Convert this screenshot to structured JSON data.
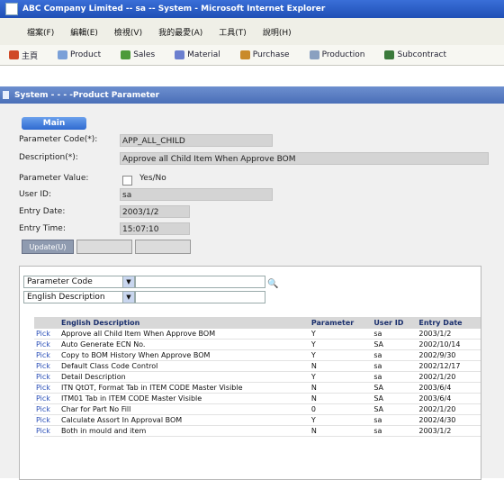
{
  "window": {
    "title": "ABC Company Limited -- sa -- System - Microsoft Internet Explorer"
  },
  "menu": [
    "檔案(F)",
    "編輯(E)",
    "檢視(V)",
    "我的最愛(A)",
    "工具(T)",
    "說明(H)"
  ],
  "modules": [
    {
      "label": "主頁",
      "icon": "home-icon",
      "color": "#d04a28"
    },
    {
      "label": "Product",
      "icon": "product-icon",
      "color": "#7aa0d8"
    },
    {
      "label": "Sales",
      "icon": "sales-icon",
      "color": "#4c9a3a"
    },
    {
      "label": "Material",
      "icon": "material-icon",
      "color": "#6b7fcf"
    },
    {
      "label": "Purchase",
      "icon": "purchase-icon",
      "color": "#c98a2a"
    },
    {
      "label": "Production",
      "icon": "production-icon",
      "color": "#8aa0c0"
    },
    {
      "label": "Subcontract",
      "icon": "subcontract-icon",
      "color": "#3b7a3b"
    }
  ],
  "page": {
    "breadcrumb": "System - - - -Product Parameter",
    "tab": "Main"
  },
  "form": {
    "code_label": "Parameter Code(*):",
    "code_value": "APP_ALL_CHILD",
    "desc_label": "Description(*):",
    "desc_value": "Approve all Child Item When Approve BOM",
    "pvalue_label": "Parameter Value:",
    "pvalue_text": "Yes/No",
    "user_label": "User ID:",
    "user_value": "sa",
    "entry_date_label": "Entry Date:",
    "entry_date_value": "2003/1/2",
    "entry_time_label": "Entry Time:",
    "entry_time_value": "15:07:10",
    "update_button": "Update(U)",
    "button2": "",
    "button3": ""
  },
  "search": {
    "field1": "Parameter Code",
    "field2": "English Description",
    "input1_value": "",
    "input2_value": ""
  },
  "table": {
    "headers": {
      "desc": "English Description",
      "param": "Parameter",
      "user": "User ID",
      "date": "Entry Date"
    },
    "rows": [
      {
        "pick": "Pick",
        "desc": "Approve all Child Item When Approve BOM",
        "param": "Y",
        "user": "sa",
        "date": "2003/1/2"
      },
      {
        "pick": "Pick",
        "desc": "Auto Generate ECN No.",
        "param": "Y",
        "user": "SA",
        "date": "2002/10/14"
      },
      {
        "pick": "Pick",
        "desc": "Copy to BOM History When Approve BOM",
        "param": "Y",
        "user": "sa",
        "date": "2002/9/30"
      },
      {
        "pick": "Pick",
        "desc": "Default Class Code Control",
        "param": "N",
        "user": "sa",
        "date": "2002/12/17"
      },
      {
        "pick": "Pick",
        "desc": "Detail Description",
        "param": "Y",
        "user": "sa",
        "date": "2002/1/20"
      },
      {
        "pick": "Pick",
        "desc": "ITN QtOT, Format Tab in ITEM CODE Master Visible",
        "param": "N",
        "user": "SA",
        "date": "2003/6/4"
      },
      {
        "pick": "Pick",
        "desc": "ITM01 Tab in ITEM CODE Master Visible",
        "param": "N",
        "user": "SA",
        "date": "2003/6/4"
      },
      {
        "pick": "Pick",
        "desc": "Char for Part No Fill",
        "param": "0",
        "user": "SA",
        "date": "2002/1/20"
      },
      {
        "pick": "Pick",
        "desc": "Calculate Assort In Approval BOM",
        "param": "Y",
        "user": "sa",
        "date": "2002/4/30"
      },
      {
        "pick": "Pick",
        "desc": "Both in mould and item",
        "param": "N",
        "user": "sa",
        "date": "2003/1/2"
      }
    ]
  }
}
